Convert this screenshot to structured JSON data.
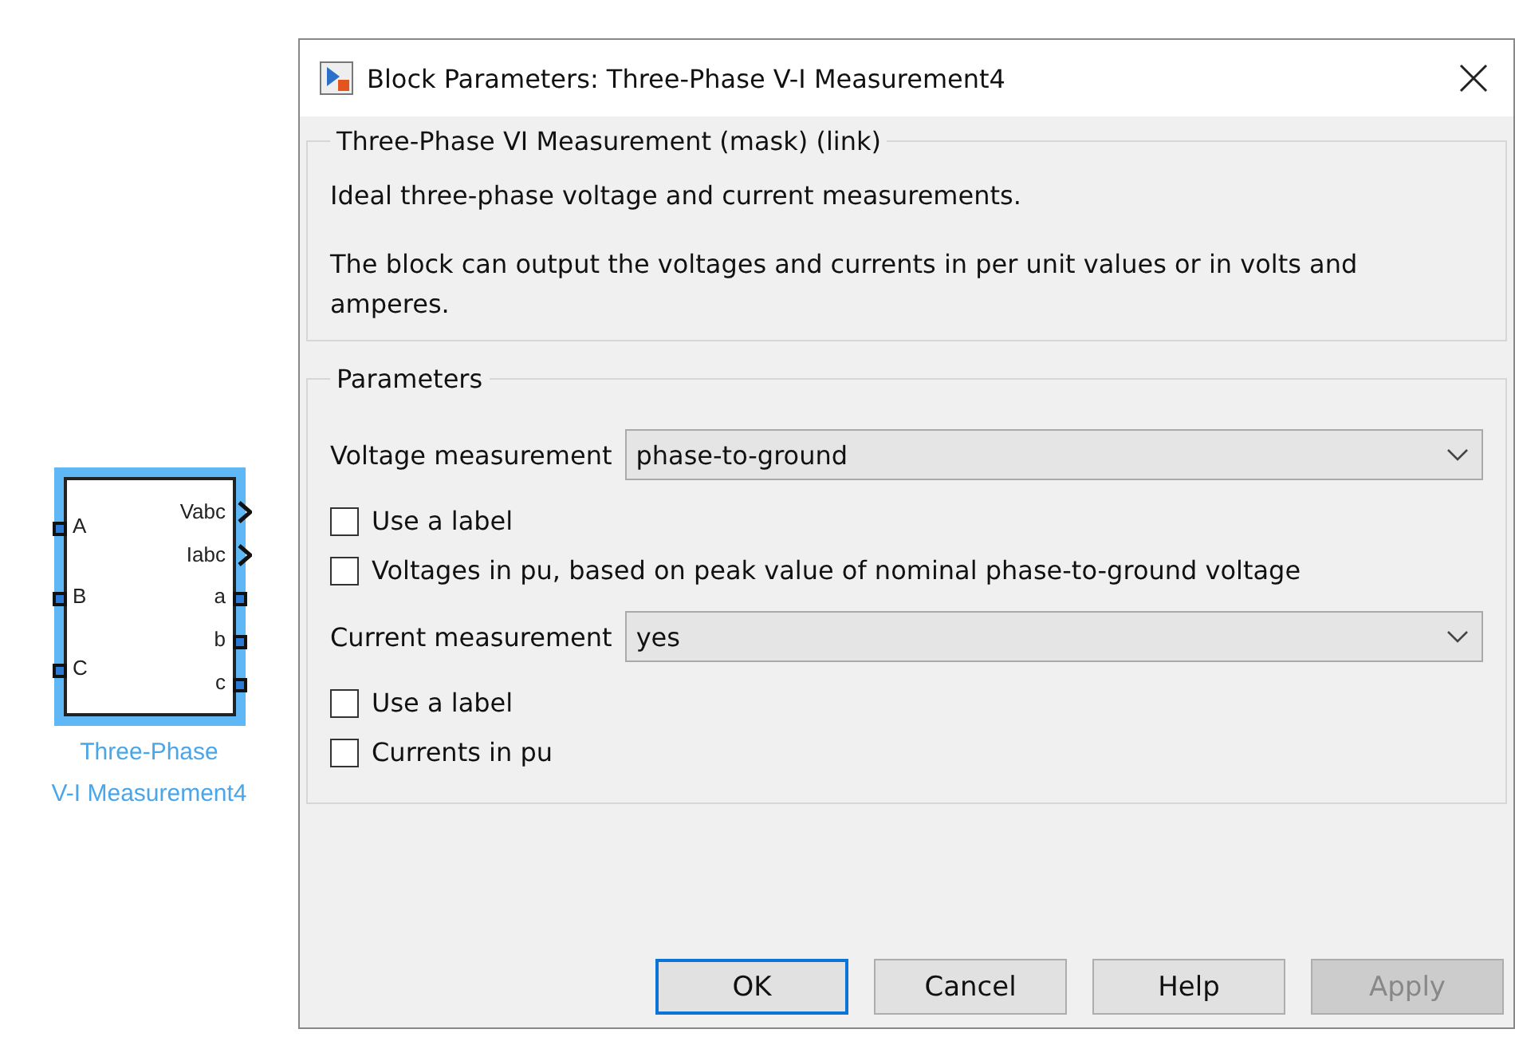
{
  "block": {
    "selected": true,
    "label_lines": [
      "Three-Phase",
      "V-I Measurement4"
    ],
    "inputs": [
      "A",
      "B",
      "C"
    ],
    "outputs": [
      {
        "label": "Vabc",
        "kind": "signal"
      },
      {
        "label": "Iabc",
        "kind": "signal"
      },
      {
        "label": "a",
        "kind": "port"
      },
      {
        "label": "b",
        "kind": "port"
      },
      {
        "label": "c",
        "kind": "port"
      }
    ]
  },
  "dialog": {
    "title": "Block Parameters: Three-Phase V-I Measurement4",
    "description_group": {
      "title": "Three-Phase VI Measurement (mask) (link)",
      "paragraphs": [
        "Ideal three-phase voltage and current measurements.",
        "The block can output the voltages and currents in per unit values or in volts and amperes."
      ]
    },
    "parameters_group": {
      "title": "Parameters",
      "rows": [
        {
          "kind": "select",
          "label": "Voltage measurement",
          "value": "phase-to-ground"
        },
        {
          "kind": "checkbox",
          "label": "Use a label",
          "checked": false
        },
        {
          "kind": "checkbox",
          "label": "Voltages in pu,  based on peak value of nominal phase-to-ground voltage",
          "checked": false
        },
        {
          "kind": "select",
          "label": "Current measurement",
          "value": "yes"
        },
        {
          "kind": "checkbox",
          "label": "Use a label",
          "checked": false
        },
        {
          "kind": "checkbox",
          "label": "Currents in pu",
          "checked": false
        }
      ]
    },
    "buttons": [
      {
        "label": "OK",
        "default": true,
        "disabled": false
      },
      {
        "label": "Cancel",
        "default": false,
        "disabled": false
      },
      {
        "label": "Help",
        "default": false,
        "disabled": false
      },
      {
        "label": "Apply",
        "default": false,
        "disabled": true
      }
    ]
  }
}
